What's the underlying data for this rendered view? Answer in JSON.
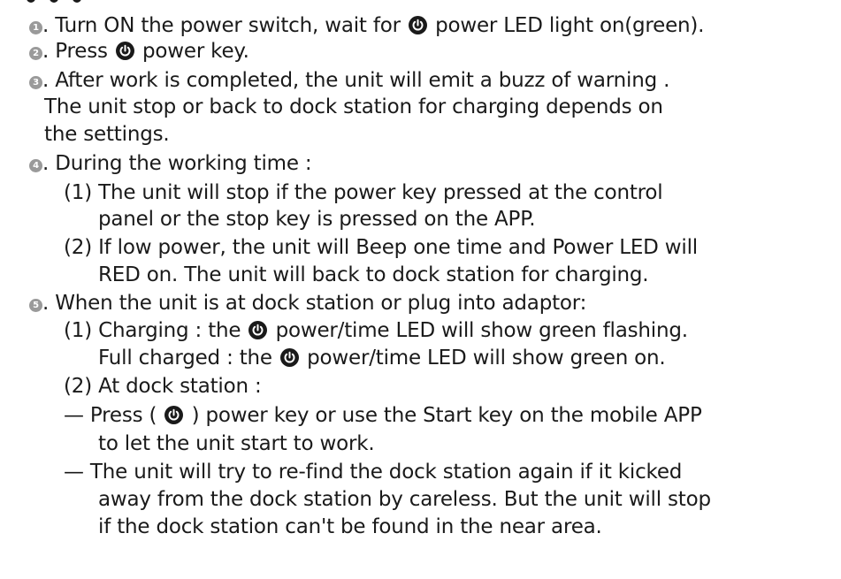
{
  "icons": {
    "step_marker": "circled-number-icon",
    "power": "power-button-icon"
  },
  "colors": {
    "text": "#1a1a1a",
    "step_marker": "#9a9a9a",
    "power_icon": "#1a1a1a"
  },
  "steps": [
    {
      "marker": "1",
      "lines": [
        {
          "a": ". Turn ON the power switch, wait for ",
          "b": " power LED light on(green)."
        }
      ]
    },
    {
      "marker": "2",
      "lines": [
        {
          "a": ". Press ",
          "b": " power key."
        }
      ]
    },
    {
      "marker": "3",
      "lines": [
        {
          "a": ". After work is completed, the unit will emit a buzz of warning ."
        },
        {
          "a": "The unit stop or back to dock station for charging depends on"
        },
        {
          "a": "the settings."
        }
      ]
    },
    {
      "marker": "4",
      "lines": [
        {
          "a": ". During the working time :"
        },
        {
          "a": "(1) The unit will stop if the power key pressed at the control"
        },
        {
          "a": "panel or the stop key is pressed on the APP."
        },
        {
          "a": "(2) If low power, the unit will Beep one time and Power LED will"
        },
        {
          "a": "RED on. The unit will back to dock station for charging."
        }
      ]
    },
    {
      "marker": "5",
      "lines": [
        {
          "a": ". When the unit is at dock station or plug into adaptor:"
        },
        {
          "a": "(1) Charging : the ",
          "b": " power/time LED will show green flashing."
        },
        {
          "a": "Full charged : the ",
          "b": " power/time LED will show green on."
        },
        {
          "a": "(2) At dock station :"
        },
        {
          "a": "— Press ( ",
          "b": " ) power key or use the Start key on the mobile APP"
        },
        {
          "a": "to let the unit start to work."
        },
        {
          "a": "— The unit will try to re-find the dock station again if it kicked"
        },
        {
          "a": "away from the dock station by careless. But the unit will stop"
        },
        {
          "a": "if the dock station can't be found in the near area."
        }
      ]
    }
  ]
}
